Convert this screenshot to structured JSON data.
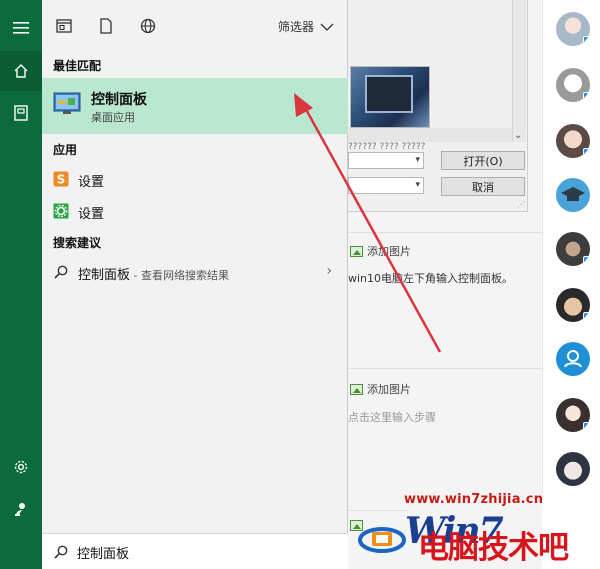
{
  "start_menu": {
    "filter_label": "筛选器",
    "sections": {
      "best_match": "最佳匹配",
      "apps": "应用",
      "suggestions": "搜索建议"
    },
    "best_match_item": {
      "title": "控制面板",
      "subtitle": "桌面应用"
    },
    "apps": [
      {
        "label": "设置",
        "icon": "settings-orange-icon"
      },
      {
        "label": "设置",
        "icon": "settings-green-icon"
      }
    ],
    "suggestion": {
      "label": "控制面板",
      "sub": " - 查看网络搜索结果"
    },
    "search_value": "控制面板"
  },
  "background_app": {
    "open_button": "打开(O)",
    "cancel_button": "取消",
    "add_picture_1": "添加图片",
    "step_text": "win10电脑左下角输入控制面板。",
    "add_picture_2": "添加图片",
    "step_placeholder": "点击这里输入步骤",
    "cut_text": "?????? ???? ?????"
  },
  "watermark": {
    "url": "www.win7zhijia.cn",
    "logo_text": "Win7",
    "site_name": "电脑技术吧"
  },
  "colors": {
    "rail": "#0b6b3a",
    "highlight": "#b9e7cf",
    "arrow": "#d9363e",
    "watermark_red": "#d9141b"
  }
}
